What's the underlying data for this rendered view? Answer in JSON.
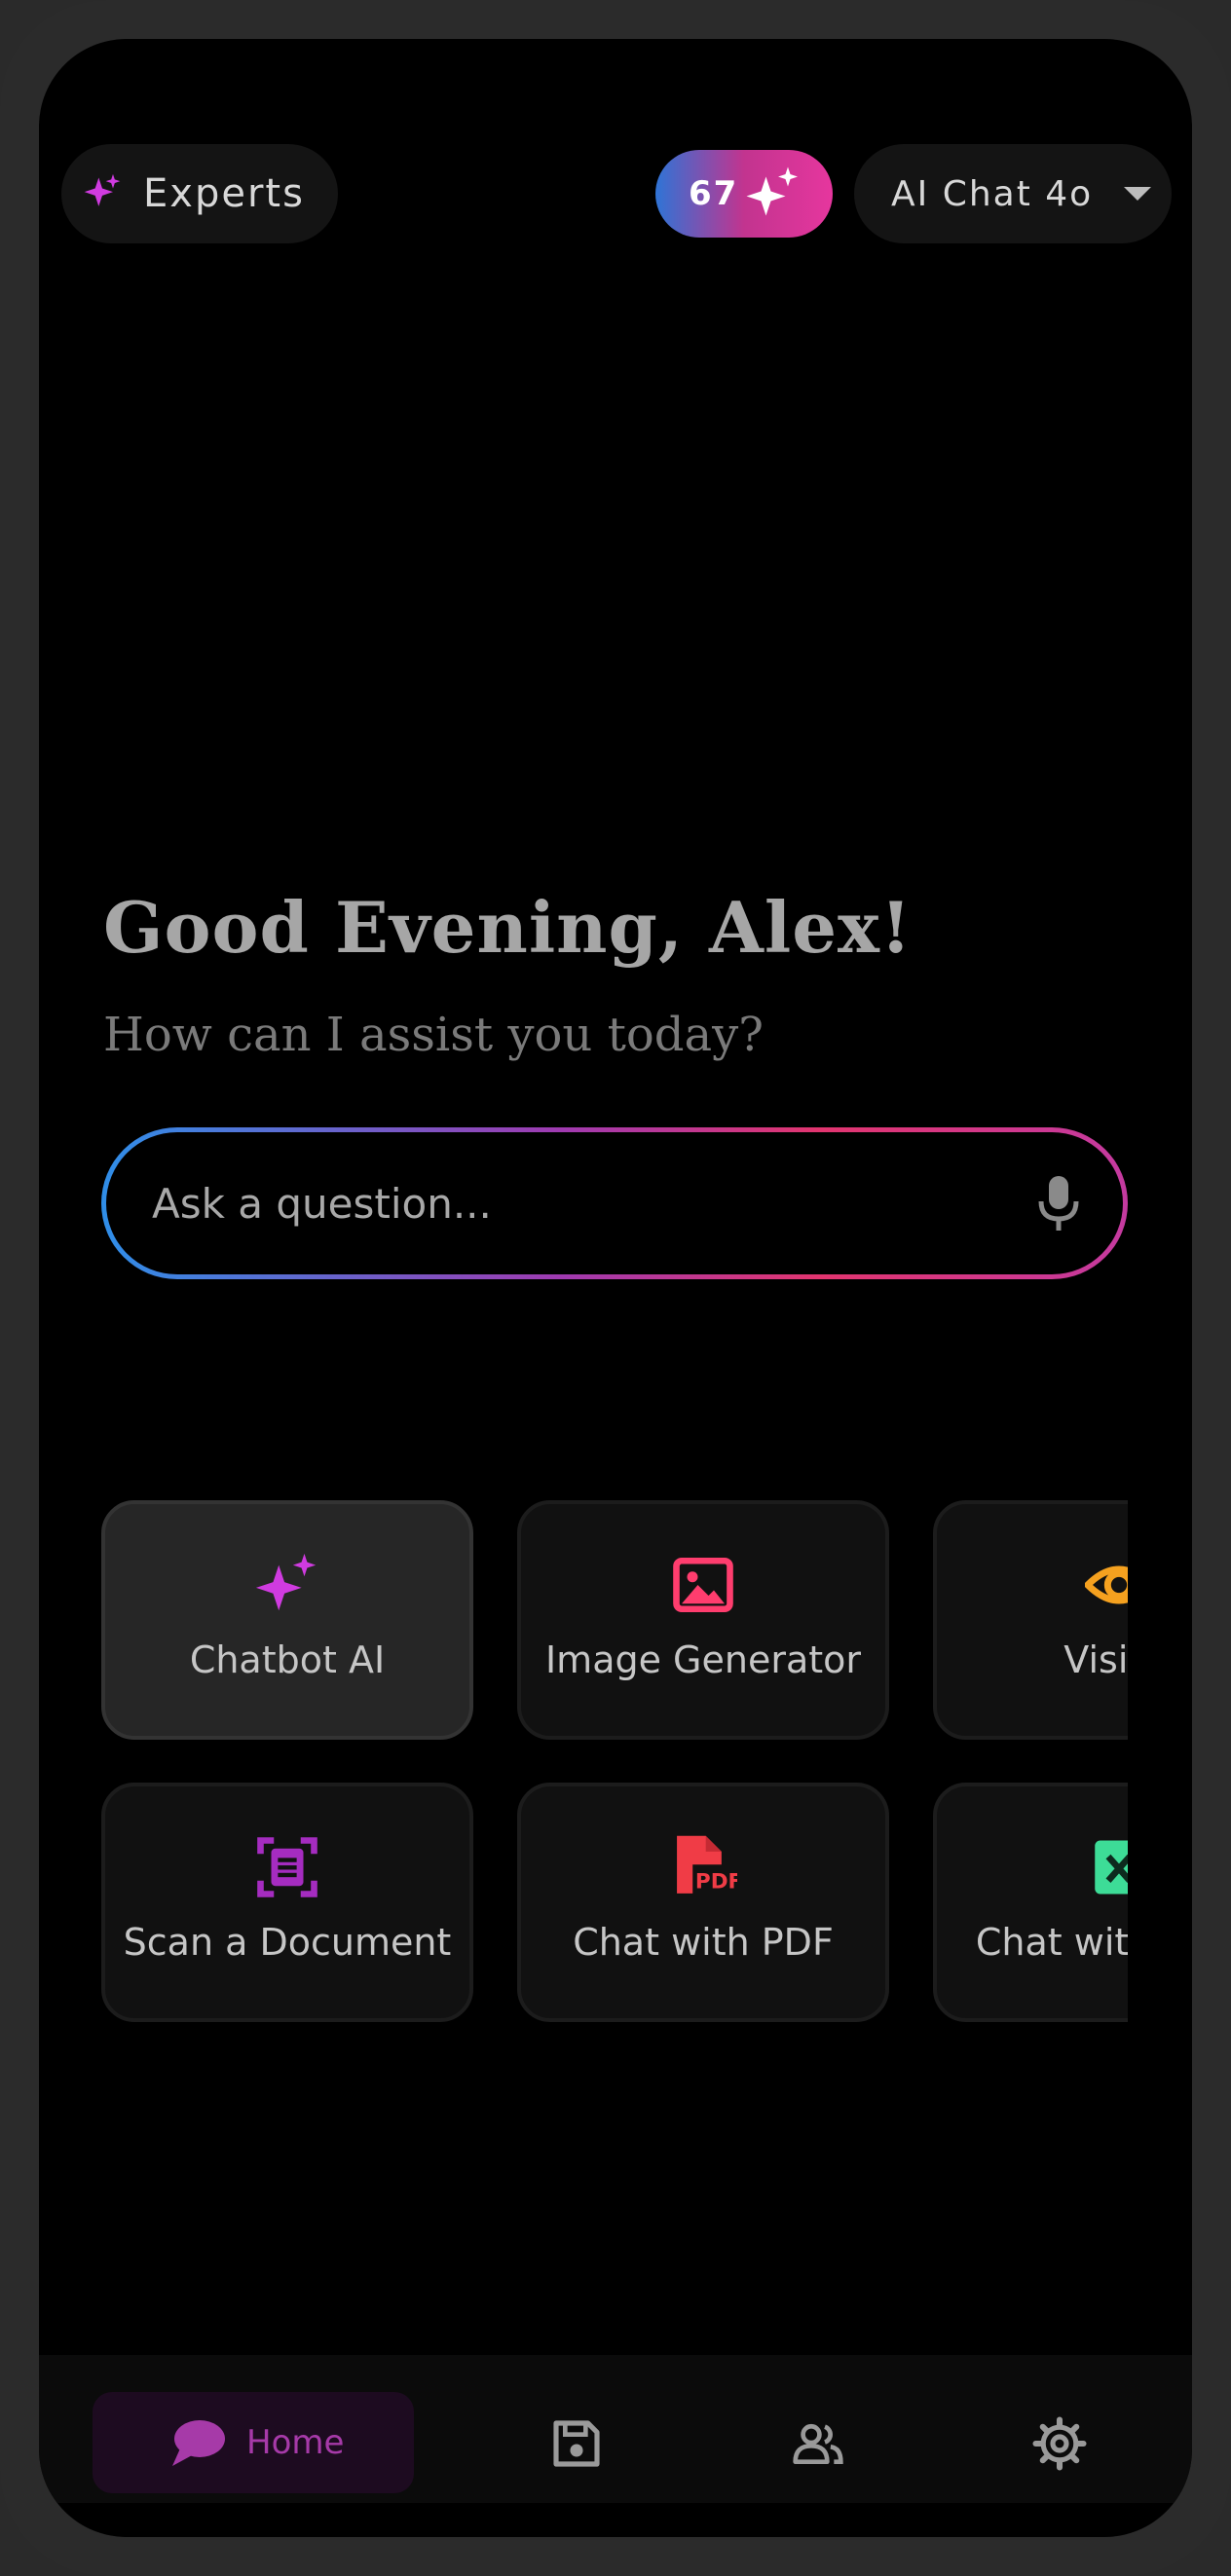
{
  "header": {
    "experts_label": "Experts",
    "experts_icon": "sparkles-icon",
    "credits_count": "67",
    "credits_icon": "sparkles-icon",
    "model_label": "AI Chat 4o",
    "model_icon": "chevron-down-icon"
  },
  "greeting": {
    "title": "Good Evening, Alex!",
    "subtitle": "How can I assist you today?"
  },
  "search": {
    "placeholder": "Ask a question...",
    "mic_icon": "microphone-icon"
  },
  "tools": [
    {
      "label": "Chatbot AI",
      "icon": "sparkles-icon",
      "color": "#d03be0"
    },
    {
      "label": "Image Generator",
      "icon": "image-icon",
      "color": "#ff3d6e"
    },
    {
      "label": "Vision",
      "icon": "eye-icon",
      "color": "#f5a11f"
    },
    {
      "label": "Scan a Document",
      "icon": "document-scan-icon",
      "color": "#a52cc0"
    },
    {
      "label": "Chat with PDF",
      "icon": "pdf-file-icon",
      "color": "#f03c46"
    },
    {
      "label": "Chat with Excel",
      "icon": "excel-file-icon",
      "color": "#3ddc97"
    }
  ],
  "nav": {
    "home_label": "Home",
    "saved_icon": "floppy-disk-icon",
    "community_icon": "people-icon",
    "settings_icon": "gear-icon"
  },
  "colors": {
    "accent_purple": "#a63aa8",
    "gradient_blue": "#2f8ee8",
    "gradient_pink": "#e2356f"
  }
}
